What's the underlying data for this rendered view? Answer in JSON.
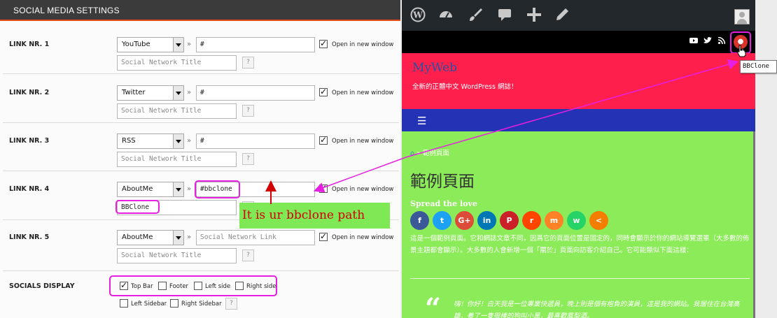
{
  "settings": {
    "header": "SOCIAL MEDIA SETTINGS",
    "separator": "»",
    "open_new_window": "Open in new window",
    "help": "?",
    "links": [
      {
        "label": "LINK NR. 1",
        "network": "YouTube",
        "url": "#",
        "url_is_placeholder": false,
        "title": "Social Network Title",
        "title_is_placeholder": true,
        "new_window": true
      },
      {
        "label": "LINK NR. 2",
        "network": "Twitter",
        "url": "#",
        "url_is_placeholder": false,
        "title": "Social Network Title",
        "title_is_placeholder": true,
        "new_window": true
      },
      {
        "label": "LINK NR. 3",
        "network": "RSS",
        "url": "#",
        "url_is_placeholder": false,
        "title": "Social Network Title",
        "title_is_placeholder": true,
        "new_window": true
      },
      {
        "label": "LINK NR. 4",
        "network": "AboutMe",
        "url": "#bbclone",
        "url_is_placeholder": false,
        "title": "BBClone",
        "title_is_placeholder": false,
        "new_window": true
      },
      {
        "label": "LINK NR. 5",
        "network": "AboutMe",
        "url": "Social Network Link",
        "url_is_placeholder": true,
        "title": "Social Network Title",
        "title_is_placeholder": true,
        "new_window": true
      }
    ],
    "display": {
      "label": "SOCIALS DISPLAY",
      "options": [
        {
          "label": "Top Bar",
          "checked": true
        },
        {
          "label": "Footer",
          "checked": false
        },
        {
          "label": "Left side",
          "checked": false
        },
        {
          "label": "Right side",
          "checked": false
        },
        {
          "label": "Left Sidebar",
          "checked": false
        },
        {
          "label": "Right Sidebar",
          "checked": false
        }
      ]
    }
  },
  "annotation": {
    "text": "It is ur bbclone path",
    "color": "#d30000",
    "highlight_color": "#e61fe0"
  },
  "preview": {
    "admin_bar_icons": [
      "wordpress-icon",
      "dashboard-icon",
      "brush-icon",
      "comment-icon",
      "plus-icon",
      "edit-icon"
    ],
    "topbar_icons": [
      "youtube-icon",
      "twitter-icon",
      "rss-icon",
      "aboutme-icon"
    ],
    "tooltip": "BBClone",
    "site_title": "MyWeb",
    "tagline": "全新的正體中文 WordPress 網誌！",
    "menu_icon": "☰",
    "breadcrumb_sep": "»",
    "breadcrumb_current": "範例頁面",
    "page_title": "範例頁面",
    "spread_title": "Spread the love",
    "share_buttons": [
      {
        "name": "facebook",
        "glyph": "f",
        "color": "#3b5998"
      },
      {
        "name": "twitter",
        "glyph": "t",
        "color": "#1da1f2"
      },
      {
        "name": "google-plus",
        "glyph": "G+",
        "color": "#dd4b39"
      },
      {
        "name": "linkedin",
        "glyph": "in",
        "color": "#0077b5"
      },
      {
        "name": "pinterest",
        "glyph": "P",
        "color": "#cb2027"
      },
      {
        "name": "reddit",
        "glyph": "r",
        "color": "#ff4500"
      },
      {
        "name": "mix",
        "glyph": "m",
        "color": "#ff8226"
      },
      {
        "name": "whatsapp",
        "glyph": "w",
        "color": "#25d366"
      },
      {
        "name": "share",
        "glyph": "<",
        "color": "#f57d00"
      }
    ],
    "body_text": "這是一個範例頁面。它和網誌文章不同，因爲它的頁面位置是固定的，同時會顯示於你的網站導覽選單（大多數的佈景主題都會顯示）。大多數的人會新增一個「關於」頁面向訪客介紹自己。它可能類似下面這樣：",
    "quote_mark": "“",
    "quote_text": "嗨！你好！白天我是一位專業快遞員，晚上則是個有抱負的演員，這是我的網站。我居住在台灣高雄，養了一隻很棒的狗叫小黑，最喜歡鳳梨酒。"
  }
}
